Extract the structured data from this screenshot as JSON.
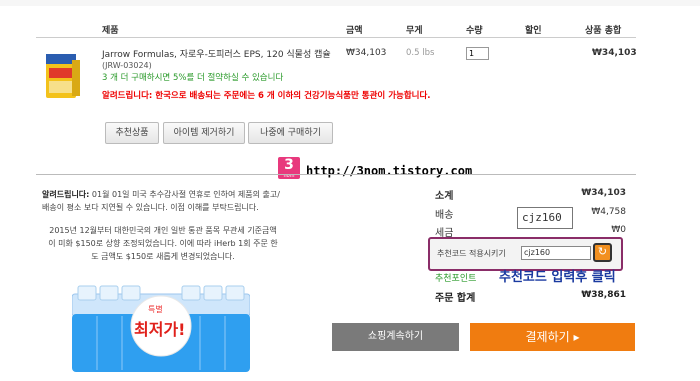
{
  "table_header": {
    "product": "제품",
    "price": "금액",
    "weight": "무게",
    "qty": "수량",
    "discount": "할인",
    "total": "상품 총합"
  },
  "item": {
    "name": "Jarrow Formulas, 자로우-도피러스 EPS, 120 식물성 캡슐",
    "code": "(JRW-03024)",
    "discount_note": "3 개 더 구매하시면 5%를 더 절약하실 수 있습니다",
    "notice": "알려드립니다: 한국으로 배송되는 주문에는 6 개 이하의 건강기능식품만 통관이 가능합니다.",
    "price": "₩34,103",
    "weight": "0.5 lbs",
    "qty": "1",
    "total": "₩34,103"
  },
  "item_actions": {
    "recommend": "추천상품",
    "remove": "아이템 제거하기",
    "later": "나중에 구매하기"
  },
  "watermark": {
    "badge": "3",
    "badge_sub": "nom",
    "url": "http://3nom.tistory.com"
  },
  "notice": {
    "title": "알려드립니다:",
    "text1": " 01월 01일 미국 추수감사절 연휴로 인하여 제품의 출고/배송이 평소 보다 지연될 수 있습니다. 이점 이해를 부탁드립니다.",
    "text2": "2015년 12월부터 대한민국의 개인 일반 통관 품목 무관세 기준금액이 미화 $150로 상향 조정되었습니다. 이에 따라 iHerb 1회 주문 한도 금액도 $150로 새롭게 변경되었습니다."
  },
  "promo": {
    "small": "특별",
    "big": "최저가!"
  },
  "summary": {
    "subtotal_label": "소계",
    "subtotal": "₩34,103",
    "shipping_label": "배송",
    "shipping": "₩4,758",
    "tax_label": "세금",
    "tax": "₩0",
    "coupon_label": "추천코드 적용시키기",
    "coupon_value": "cjz160",
    "coupon_big": "cjz160",
    "points_label": "추천포인트",
    "coupon_note": "추천코드 입력후 클릭",
    "grand_label": "주문 합계",
    "grand_total": "₩38,861"
  },
  "footer": {
    "continue": "쇼핑계속하기",
    "checkout": "결제하기 ▸"
  },
  "colors": {
    "accent": "#f07c10",
    "highlight_border": "#8a2d68",
    "green": "#2a9a2a",
    "red": "#e00000",
    "badge": "#e8397d"
  }
}
